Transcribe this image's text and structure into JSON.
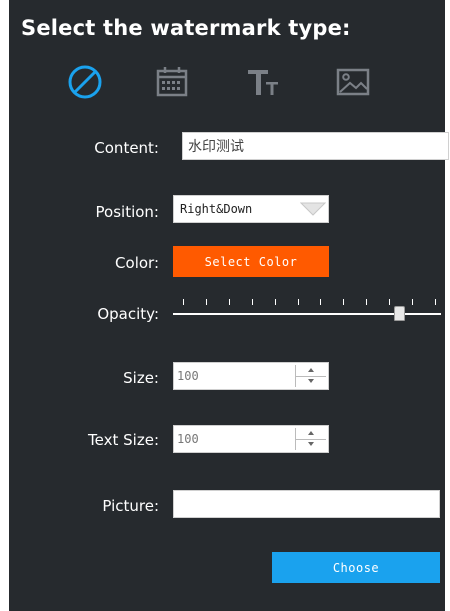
{
  "title": "Select the watermark type:",
  "type_icons": [
    "none-icon",
    "calendar-icon",
    "text-icon",
    "image-icon"
  ],
  "colors": {
    "panel_bg": "#262a2e",
    "accent_blue": "#1aa2ee",
    "color_swatch": "#ff5a00"
  },
  "content": {
    "label": "Content:",
    "value": "水印测试"
  },
  "position": {
    "label": "Position:",
    "value": "Right&Down"
  },
  "color": {
    "label": "Color:",
    "button": "Select Color"
  },
  "opacity": {
    "label": "Opacity:",
    "value_fraction": 0.86
  },
  "size": {
    "label": "Size:",
    "value": "100"
  },
  "text_size": {
    "label": "Text Size:",
    "value": "100"
  },
  "picture": {
    "label": "Picture:",
    "value": ""
  },
  "choose_button": "Choose"
}
